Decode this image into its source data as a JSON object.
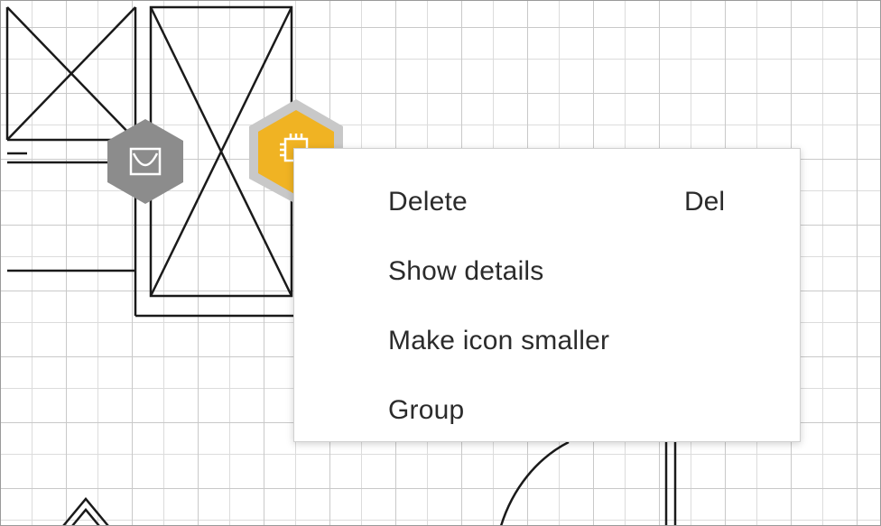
{
  "context_menu": {
    "items": [
      {
        "label": "Delete",
        "shortcut": "Del"
      },
      {
        "label": "Show details",
        "shortcut": ""
      },
      {
        "label": "Make icon smaller",
        "shortcut": ""
      },
      {
        "label": "Group",
        "shortcut": ""
      }
    ]
  },
  "icons": {
    "grey_node": {
      "name": "bucket-icon",
      "color": "#8c8c8c"
    },
    "yellow_node": {
      "name": "chip-icon",
      "color": "#f0b323"
    }
  },
  "colors": {
    "grid_major": "#c9c9c9",
    "grid_minor": "#dcdcdc",
    "line": "#1a1a1a"
  }
}
